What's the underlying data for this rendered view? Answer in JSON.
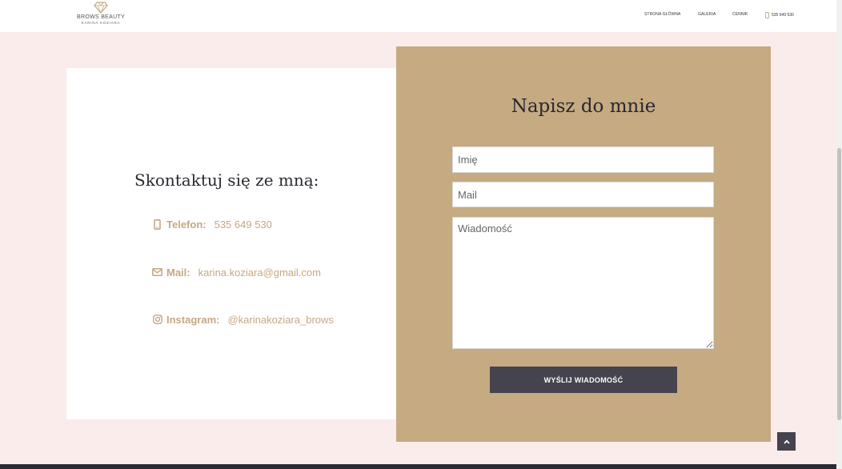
{
  "header": {
    "logo": {
      "title": "BROWS BEAUTY",
      "subtitle": "KARINA KOZIARA",
      "icon": "diamond-icon"
    },
    "nav": [
      {
        "label": "STRONA GŁÓWNA"
      },
      {
        "label": "GALERIA"
      },
      {
        "label": "CENNIK"
      }
    ],
    "phone": {
      "label": "535 649 530",
      "icon": "mobile-phone-icon"
    }
  },
  "contact": {
    "heading": "Skontaktuj się ze mną:",
    "items": [
      {
        "label": "Telefon:",
        "value": "535 649 530",
        "icon": "mobile-phone-icon"
      },
      {
        "label": "Mail:",
        "value": "karina.koziara@gmail.com",
        "icon": "envelope-icon"
      },
      {
        "label": "Instagram:",
        "value": "@karinakoziara_brows",
        "icon": "instagram-icon"
      }
    ]
  },
  "form": {
    "title": "Napisz do mnie",
    "name_placeholder": "Imię",
    "mail_placeholder": "Mail",
    "message_placeholder": "Wiadomość",
    "submit_label": "WYŚLIJ WIADOMOŚĆ"
  },
  "scroll_top": {
    "icon": "chevron-up-icon"
  },
  "colors": {
    "page_background": "#f9eceb",
    "accent_gold": "#c5aa82",
    "label_gold": "#c4a882",
    "dark_button": "#45434e",
    "heading_text": "#2b2730"
  }
}
